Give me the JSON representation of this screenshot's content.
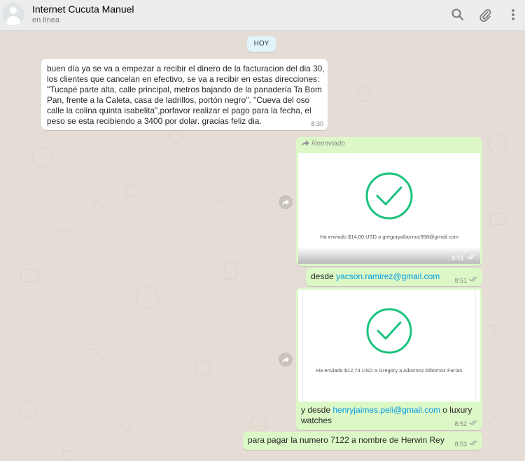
{
  "header": {
    "contact_name": "Internet Cucuta Manuel",
    "status": "en línea",
    "icons": [
      "avatar-icon",
      "search-icon",
      "attach-icon",
      "menu-icon"
    ]
  },
  "day_divider": "HOY",
  "messages": [
    {
      "direction": "incoming",
      "text": "buen día ya se va a empezar a recibir el dinero de la facturacion del dia 30, los clientes que cancelan en efectivo, se va a recibir en estas direcciones: \"Tucapé parte alta, calle principal, metros bajando de la panadería Ta Bom Pan, frente a la Caleta, casa de ladrillos, portón negro\". \"Cueva del oso calle la colina quinta isabelita\",porfavor realizar el pago para la fecha, el peso se esta recibiendo a 3400 por dolar. gracias feliz dia.",
      "time": "8:30"
    },
    {
      "direction": "outgoing",
      "type": "image",
      "forwarded_label": "Reenviado",
      "image_caption": "Ha enviado $14,00 USD a gregoryalbornoz958@gmail.com",
      "time": "8:51"
    },
    {
      "direction": "outgoing",
      "text_prefix": "desde ",
      "link": "yacson.ramirez@gmail.com",
      "time": "8:51"
    },
    {
      "direction": "outgoing",
      "type": "image",
      "image_caption": "Ha enviado $12,74 USD a Gregory a Albornoz Albornoz Farías",
      "text_prefix": "y desde ",
      "link": "henryjaimes.peli@gmail.com",
      "text_suffix": " o luxury watches",
      "time": "8:52"
    },
    {
      "direction": "outgoing",
      "text": "para pagar la numero 7122 a nombre de Herwin Rey",
      "time": "8:53"
    }
  ],
  "colors": {
    "header_bg": "#ededed",
    "chat_bg": "#e5ddd5",
    "incoming_bubble": "#ffffff",
    "outgoing_bubble": "#dcf8c6",
    "link": "#039be5",
    "check_green": "#19c37d",
    "read_ticks": "#9aa5a0"
  }
}
